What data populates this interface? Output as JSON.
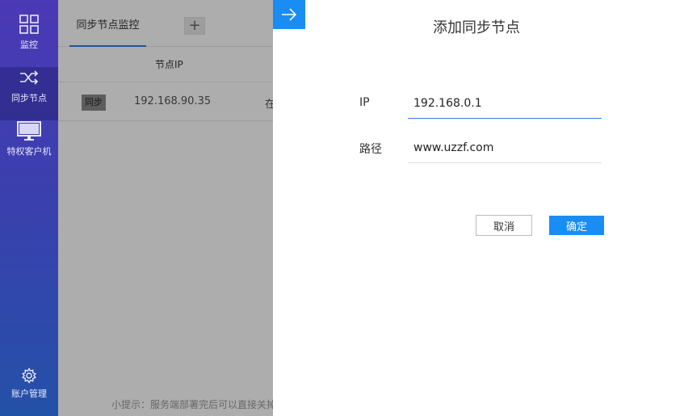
{
  "sidebar": {
    "items": [
      {
        "label": "监控",
        "icon": "grid-icon"
      },
      {
        "label": "同步节点",
        "icon": "shuffle-icon"
      },
      {
        "label": "特权客户机",
        "icon": "monitor-icon"
      }
    ],
    "account": {
      "label": "账户管理",
      "icon": "gear-icon"
    }
  },
  "main": {
    "tab_label": "同步节点监控",
    "add_tab_label": "+",
    "table": {
      "columns": [
        "节点IP"
      ],
      "rows": [
        {
          "action": "同步",
          "ip": "192.168.90.35",
          "status": "在"
        }
      ]
    },
    "hint": "小提示：服务端部署完后可以直接关掉"
  },
  "dialog": {
    "title": "添加同步节点",
    "fields": [
      {
        "label": "IP",
        "value": "192.168.0.1"
      },
      {
        "label": "路径",
        "value": "www.uzzf.com"
      }
    ],
    "cancel_label": "取消",
    "ok_label": "确定"
  },
  "colors": {
    "sidebar_top": "#4b39b5",
    "sidebar_bottom": "#2451a8",
    "accent": "#1a8df5"
  }
}
